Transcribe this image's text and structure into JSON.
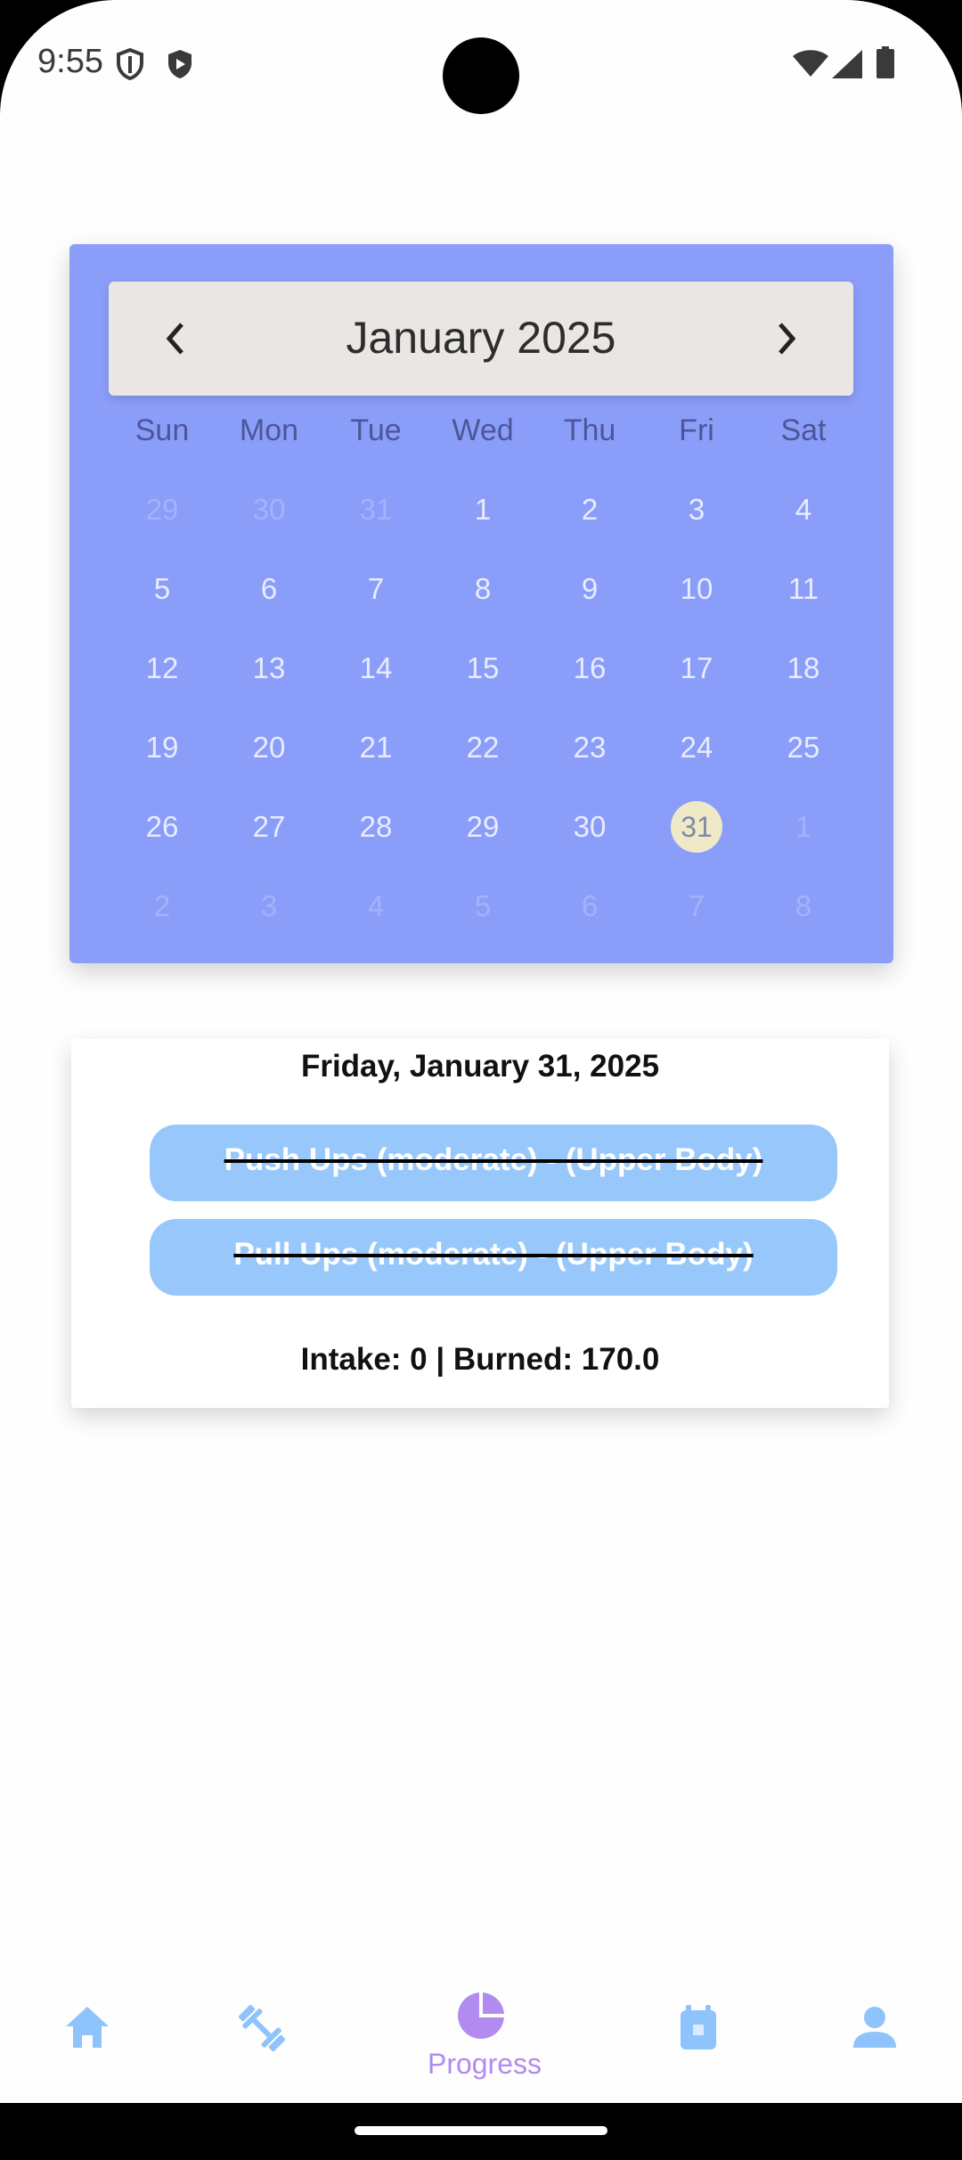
{
  "status_bar": {
    "time": "9:55",
    "icons": [
      "shield-icon",
      "play-shield-icon",
      "wifi-icon",
      "signal-icon",
      "battery-icon"
    ]
  },
  "calendar": {
    "month_title": "January 2025",
    "prev_icon": "chevron-left-icon",
    "next_icon": "chevron-right-icon",
    "weekdays": [
      "Sun",
      "Mon",
      "Tue",
      "Wed",
      "Thu",
      "Fri",
      "Sat"
    ],
    "weeks": [
      [
        "29",
        "30",
        "31",
        "1",
        "2",
        "3",
        "4"
      ],
      [
        "5",
        "6",
        "7",
        "8",
        "9",
        "10",
        "11"
      ],
      [
        "12",
        "13",
        "14",
        "15",
        "16",
        "17",
        "18"
      ],
      [
        "19",
        "20",
        "21",
        "22",
        "23",
        "24",
        "25"
      ],
      [
        "26",
        "27",
        "28",
        "29",
        "30",
        "31",
        "1"
      ],
      [
        "2",
        "3",
        "4",
        "5",
        "6",
        "7",
        "8"
      ]
    ],
    "selected_day": "31",
    "colors": {
      "card": "#8a9df9",
      "header": "#e9e6e3",
      "day_text": "#e9ecff",
      "outside_day_text": "#a3b2fb",
      "selected_circle": "#efe9c8"
    }
  },
  "summary": {
    "date": "Friday, January 31, 2025",
    "tasks": [
      {
        "label": "Push Ups (moderate) - (Upper Body)",
        "completed": true
      },
      {
        "label": "Pull Ups (moderate) - (Upper Body)",
        "completed": true
      }
    ],
    "stats": "Intake: 0 | Burned: 170.0",
    "pill_color": "#98c8fb"
  },
  "bottom_nav": {
    "items": [
      {
        "icon": "home-icon",
        "label": ""
      },
      {
        "icon": "dumbbell-icon",
        "label": ""
      },
      {
        "icon": "pie-chart-icon",
        "label": "Progress",
        "active": true
      },
      {
        "icon": "calendar-badge-icon",
        "label": ""
      },
      {
        "icon": "person-icon",
        "label": ""
      }
    ],
    "active_color": "#b18bef",
    "inactive_color": "#8ec3fb"
  }
}
